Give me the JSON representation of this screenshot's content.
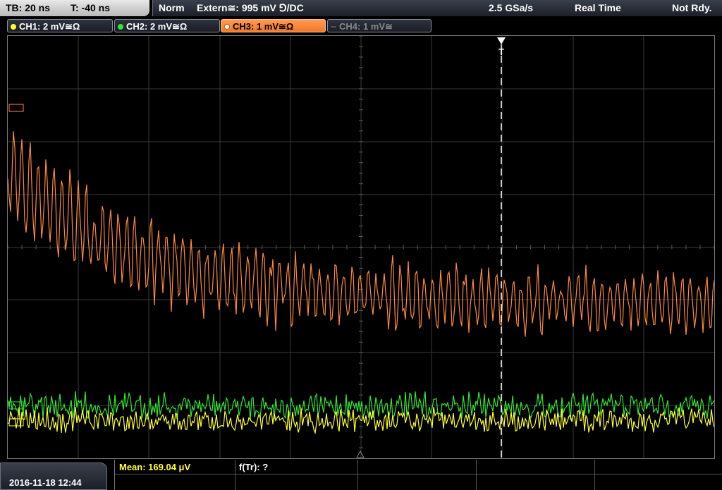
{
  "header": {
    "timebase": "TB: 20 ns",
    "trigger_pos": "T: -40 ns",
    "trigger_mode": "Norm",
    "trigger_source": "Extern≅: 995 mV ⅁/DC",
    "sample_rate": "2.5 GSa/s",
    "acq_mode": "Real Time",
    "status": "Not Rdy."
  },
  "channels": [
    {
      "label": "CH1: 2 mV≅Ω",
      "color": "#ffff30",
      "state": "on"
    },
    {
      "label": "CH2: 2 mV≅Ω",
      "color": "#30e830",
      "state": "on"
    },
    {
      "label": "CH3: 1 mV≅Ω",
      "color": "#ff8a3c",
      "state": "active"
    },
    {
      "label": "CH4: 1 mV≅",
      "color": "#666666",
      "state": "off"
    }
  ],
  "trigger_marker": "T",
  "footer": {
    "datetime": "2016-11-18 12:44",
    "mean_label": "Mean: 169.04 μV",
    "freq_label": "f(Tr): ?"
  },
  "colors": {
    "ch1": "#ffff30",
    "ch2": "#30e830",
    "ch3": "#ff8a3c",
    "grid": "#3a3a3a"
  }
}
